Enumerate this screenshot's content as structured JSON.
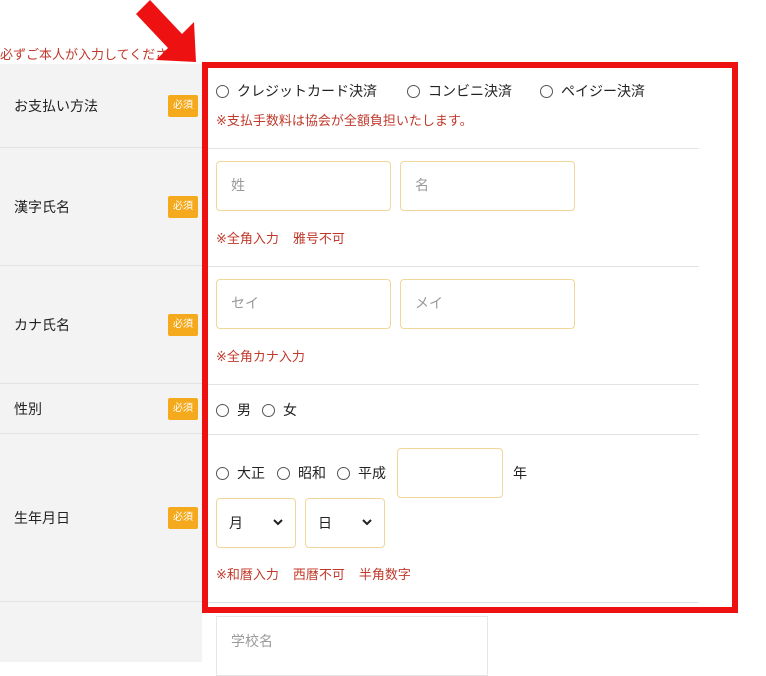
{
  "notice": "必ずご本人が入力してください。",
  "required_badge": "必須",
  "rows": {
    "payment": {
      "label": "お支払い方法",
      "options": [
        "クレジットカード決済",
        "コンビニ決済",
        "ペイジー決済"
      ],
      "note": "※支払手数料は協会が全額負担いたします。"
    },
    "kanji_name": {
      "label": "漢字氏名",
      "last_placeholder": "姓",
      "first_placeholder": "名",
      "notes": [
        "※全角入力",
        "雅号不可"
      ]
    },
    "kana_name": {
      "label": "カナ氏名",
      "last_placeholder": "セイ",
      "first_placeholder": "メイ",
      "note": "※全角カナ入力"
    },
    "gender": {
      "label": "性別",
      "options": [
        "男",
        "女"
      ]
    },
    "birthdate": {
      "label": "生年月日",
      "eras": [
        "大正",
        "昭和",
        "平成"
      ],
      "year_unit": "年",
      "month_selected": "月",
      "day_selected": "日",
      "notes": [
        "※和暦入力",
        "西暦不可",
        "半角数字"
      ]
    },
    "school": {
      "placeholder": "学校名"
    }
  },
  "colors": {
    "badge": "#f5a91c",
    "note_red": "#c0392b",
    "highlight_frame": "#ee1111",
    "label_bg": "#f3f3f3"
  }
}
